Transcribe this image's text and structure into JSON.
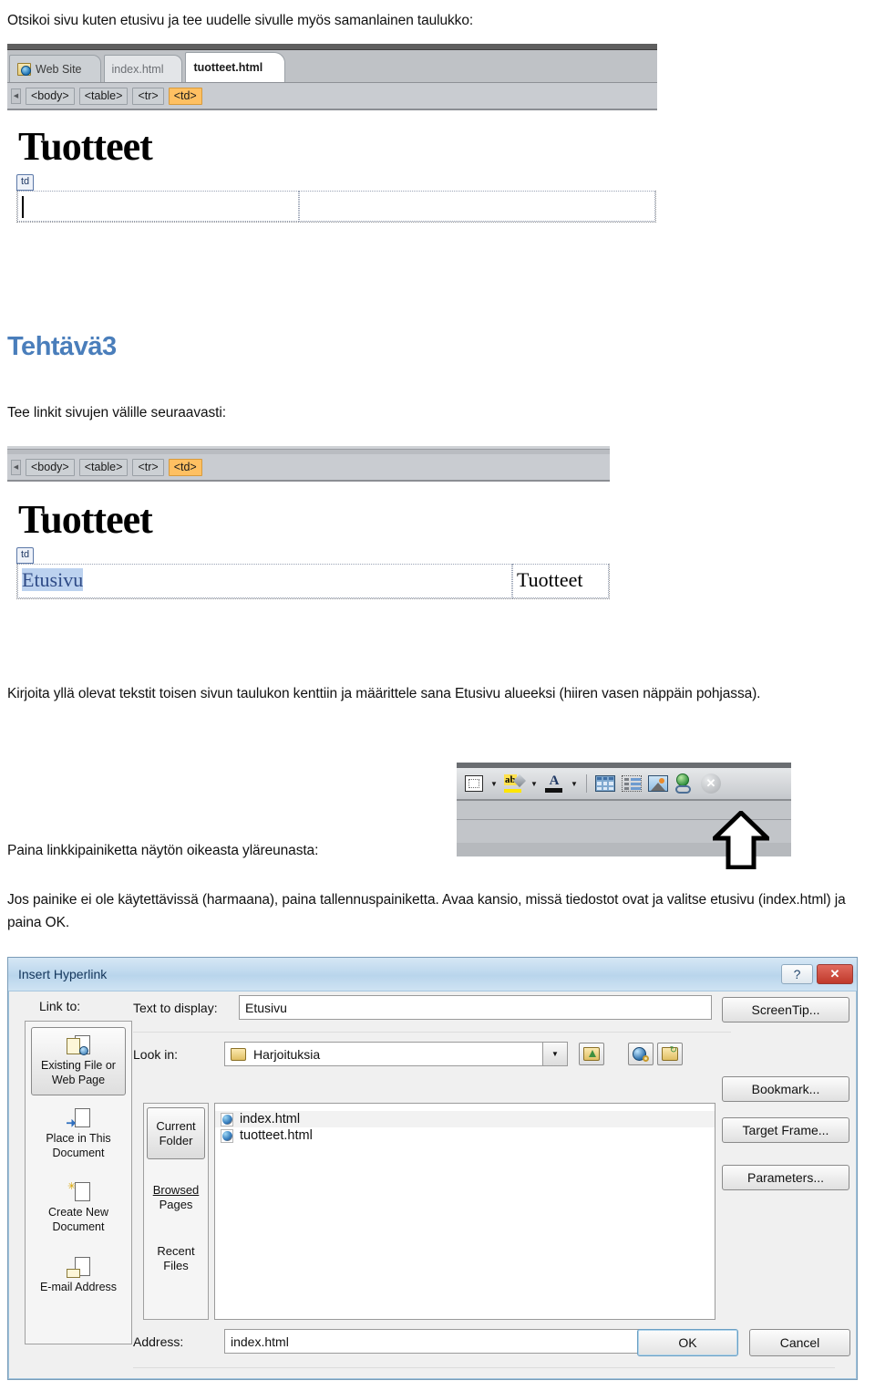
{
  "document": {
    "intro_line": "Otsikoi sivu kuten etusivu ja tee uudelle sivulle myös samanlainen taulukko:",
    "heading_tehtava": "Tehtävä3",
    "line_tee_linkit": "Tee linkit sivujen välille seuraavasti:",
    "para_kirjoita": "Kirjoita yllä olevat tekstit toisen sivun taulukon kenttiin ja määrittele sana Etusivu alueeksi (hiiren vasen näppäin pohjassa).",
    "line_paina": "Paina linkkipainiketta näytön oikeasta yläreunasta:",
    "para_jos": "Jos painike ei ole käytettävissä (harmaana), paina tallennuspainiketta. Avaa kansio, missä tiedostot ovat ja valitse etusivu (index.html) ja paina OK."
  },
  "shot1": {
    "tabs": [
      {
        "label": "Web Site",
        "state": "normal",
        "icon": "website-globe-icon"
      },
      {
        "label": "index.html",
        "state": "inactive"
      },
      {
        "label": "tuotteet.html",
        "state": "active"
      }
    ],
    "tag_bar": [
      {
        "label": "<body>",
        "selected": false
      },
      {
        "label": "<table>",
        "selected": false
      },
      {
        "label": "<tr>",
        "selected": false
      },
      {
        "label": "<td>",
        "selected": true
      }
    ],
    "page_heading": "Tuotteet",
    "td_marker": "td",
    "cell_left_text": "",
    "cell_right_text": ""
  },
  "shot2": {
    "tag_bar": [
      {
        "label": "<body>",
        "selected": false
      },
      {
        "label": "<table>",
        "selected": false
      },
      {
        "label": "<tr>",
        "selected": false
      },
      {
        "label": "<td>",
        "selected": true
      }
    ],
    "page_heading": "Tuotteet",
    "td_marker": "td",
    "cell_left_text": "Etusivu",
    "cell_right_text": "Tuotteet"
  },
  "toolbar": {
    "icons": [
      {
        "name": "borders-icon"
      },
      {
        "name": "borders-dropdown-arrow"
      },
      {
        "name": "highlight-color-icon"
      },
      {
        "name": "highlight-dropdown-arrow"
      },
      {
        "name": "font-color-icon"
      },
      {
        "name": "font-color-dropdown-arrow"
      },
      {
        "name": "insert-table-icon"
      },
      {
        "name": "insert-layer-icon"
      },
      {
        "name": "insert-picture-icon"
      },
      {
        "name": "insert-hyperlink-icon"
      },
      {
        "name": "remove-hyperlink-icon"
      }
    ]
  },
  "dialog": {
    "title": "Insert Hyperlink",
    "help_button": "?",
    "close_button": "✕",
    "link_to_label": "Link to:",
    "link_to_items": [
      {
        "label_line1": "Existing File or",
        "label_line2": "Web Page",
        "active": true,
        "icon": "existing-file-icon"
      },
      {
        "label_line1": "Place in This",
        "label_line2": "Document",
        "active": false,
        "icon": "place-in-document-icon"
      },
      {
        "label_line1": "Create New",
        "label_line2": "Document",
        "active": false,
        "icon": "create-new-document-icon"
      },
      {
        "label_line1": "E-mail Address",
        "label_line2": "",
        "active": false,
        "icon": "email-address-icon"
      }
    ],
    "text_to_display_label": "Text to display:",
    "text_to_display_value": "Etusivu",
    "look_in_label": "Look in:",
    "look_in_value": "Harjoituksia",
    "mid_tabs": [
      {
        "label_line1": "Current",
        "label_line2": "Folder",
        "active": true
      },
      {
        "label_line1": "Browsed",
        "label_line2": "Pages",
        "active": false
      },
      {
        "label_line1": "Recent",
        "label_line2": "Files",
        "active": false
      }
    ],
    "files": [
      {
        "name": "index.html",
        "icon": "firefox-html-icon",
        "highlighted": true
      },
      {
        "name": "tuotteet.html",
        "icon": "firefox-html-icon",
        "highlighted": false
      }
    ],
    "address_label": "Address:",
    "address_value": "index.html",
    "right_buttons": [
      {
        "label": "ScreenTip..."
      },
      {
        "label": "Bookmark..."
      },
      {
        "label": "Target Frame..."
      },
      {
        "label": "Parameters..."
      }
    ],
    "toolbar_icons": [
      {
        "name": "browse-up-folder-icon"
      },
      {
        "name": "browse-the-web-icon"
      },
      {
        "name": "browse-for-file-icon"
      }
    ],
    "ok_label": "OK",
    "cancel_label": "Cancel"
  },
  "colors": {
    "heading_blue": "#4a7ebb",
    "tag_selected": "#ffc062",
    "selection_blue": "#bcd2ef",
    "link_blue": "#2e4a86",
    "dialog_title": "#b9d5ec"
  }
}
